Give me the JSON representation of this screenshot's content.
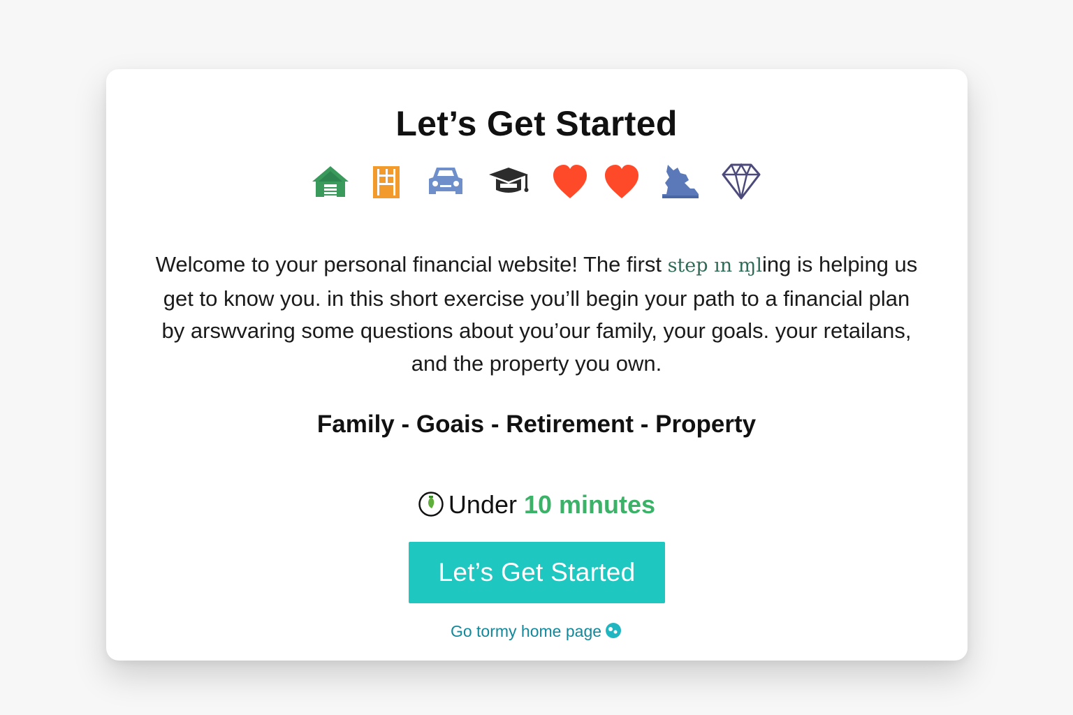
{
  "header": {
    "title": "Let’s Get Started"
  },
  "icons": [
    {
      "name": "house-icon",
      "color": "#3a9a5c"
    },
    {
      "name": "door-icon",
      "color": "#f39a2d"
    },
    {
      "name": "car-icon",
      "color": "#6f8fca"
    },
    {
      "name": "graduation-cap-icon",
      "color": "#2c2c2c"
    },
    {
      "name": "heart-icon",
      "color": "#ff4a2a"
    },
    {
      "name": "heart-icon",
      "color": "#ff4a2a"
    },
    {
      "name": "mountain-figure-icon",
      "color": "#5b79b8"
    },
    {
      "name": "diamond-icon",
      "color": "#4c4a7a"
    }
  ],
  "intro": {
    "part1": "Welcome to your personal financial website! The first ",
    "odd": "step ın ɱl",
    "part2": "ing is helping us get to know you. in this short exercise you’ll begin your path to a financial plan by arswvaring some questions about you’our family, your goals. your retailans, and the property you own."
  },
  "topics": "Family - Goais - Retirement - Property",
  "time": {
    "prefix": "Under",
    "highlight": "10 minutes",
    "highlight_color": "#3cb168"
  },
  "cta": {
    "label": "Let’s Get Started",
    "color": "#1fc7c1"
  },
  "home_link": {
    "label": "Go tormy home page",
    "color": "#13889a"
  }
}
